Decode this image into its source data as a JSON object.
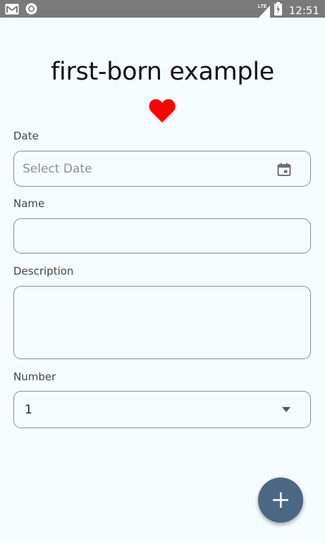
{
  "status_bar": {
    "time": "12:51",
    "network": "LTE",
    "icons": [
      "gmail-icon",
      "circle-notification-icon",
      "signal-icon",
      "battery-charging-icon"
    ]
  },
  "header": {
    "title": "first-born example",
    "heart_color": "#ff0000"
  },
  "form": {
    "date": {
      "label": "Date",
      "placeholder": "Select Date",
      "icon": "calendar-icon"
    },
    "name": {
      "label": "Name",
      "value": ""
    },
    "description": {
      "label": "Description",
      "value": ""
    },
    "number": {
      "label": "Number",
      "value": "1",
      "icon": "dropdown-arrow-icon"
    }
  },
  "fab": {
    "icon": "plus-icon",
    "color": "#4a6783"
  }
}
